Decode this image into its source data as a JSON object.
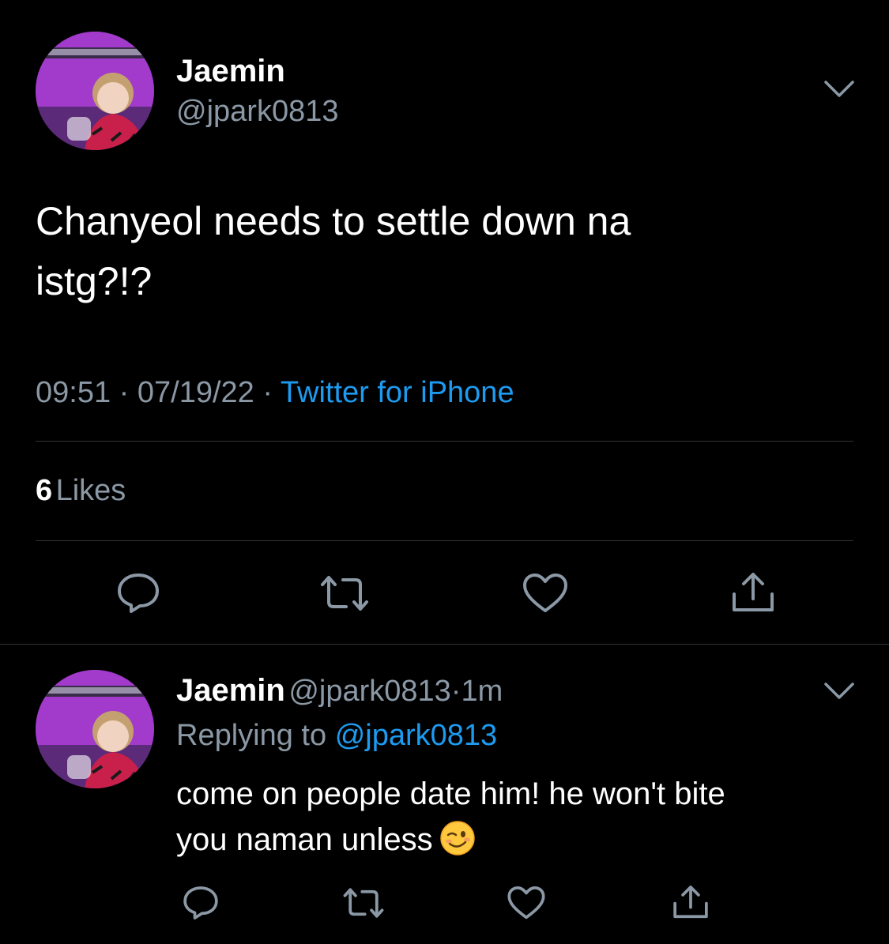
{
  "tweet": {
    "author_name": "Jaemin",
    "author_handle": "@jpark0813",
    "text_line1": "Chanyeol needs to settle down na",
    "text_line2": "istg?!?",
    "time": "09:51",
    "date": "07/19/22",
    "separator": "·",
    "source": "Twitter for iPhone",
    "likes_count": "6",
    "likes_label": "Likes"
  },
  "reply": {
    "author_name": "Jaemin",
    "author_handle": "@jpark0813",
    "separator": "·",
    "age": "1m",
    "replying_to_label": "Replying to",
    "replying_to_handle": "@jpark0813",
    "text_line1": "come on people date him! he won't bite",
    "text_line2": "you naman unless",
    "emoji": "winking-face"
  },
  "icons": {
    "reply": "speech-bubble-icon",
    "retweet": "retweet-icon",
    "like": "heart-icon",
    "share": "share-icon",
    "more": "chevron-down-icon"
  },
  "colors": {
    "background": "#000000",
    "text": "#ffffff",
    "secondary": "#8b98a5",
    "link": "#1d9bf0",
    "divider": "#2f3336"
  }
}
